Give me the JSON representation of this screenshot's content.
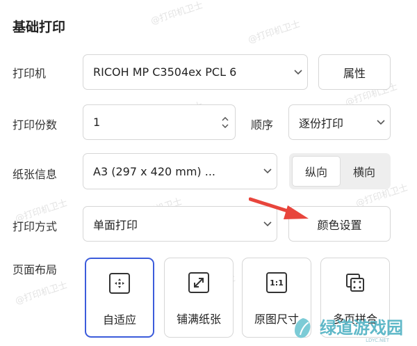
{
  "section_title": "基础打印",
  "printer": {
    "label": "打印机",
    "value": "RICOH MP C3504ex PCL 6",
    "properties_button": "属性"
  },
  "copies": {
    "label": "打印份数",
    "value": "1"
  },
  "order": {
    "label": "顺序",
    "value": "逐份打印"
  },
  "paper": {
    "label": "纸张信息",
    "value": "A3 (297 x 420 mm) ...",
    "portrait": "纵向",
    "landscape": "横向"
  },
  "print_mode": {
    "label": "打印方式",
    "value": "单面打印",
    "color_button": "颜色设置"
  },
  "layout": {
    "label": "页面布局",
    "options": [
      {
        "label": "自适应",
        "icon": "fit-page-icon",
        "selected": true
      },
      {
        "label": "铺满纸张",
        "icon": "expand-icon",
        "selected": false
      },
      {
        "label": "原图尺寸",
        "icon": "actual-size-icon",
        "selected": false
      },
      {
        "label": "多页拼合",
        "icon": "multi-page-icon",
        "selected": false
      }
    ]
  },
  "watermark": "@打印机卫士",
  "logo": {
    "name": "绿道游戏园",
    "sub": "LDYC.NET"
  },
  "colors": {
    "accent": "#3b5bdb",
    "arrow": "#e8453c"
  }
}
